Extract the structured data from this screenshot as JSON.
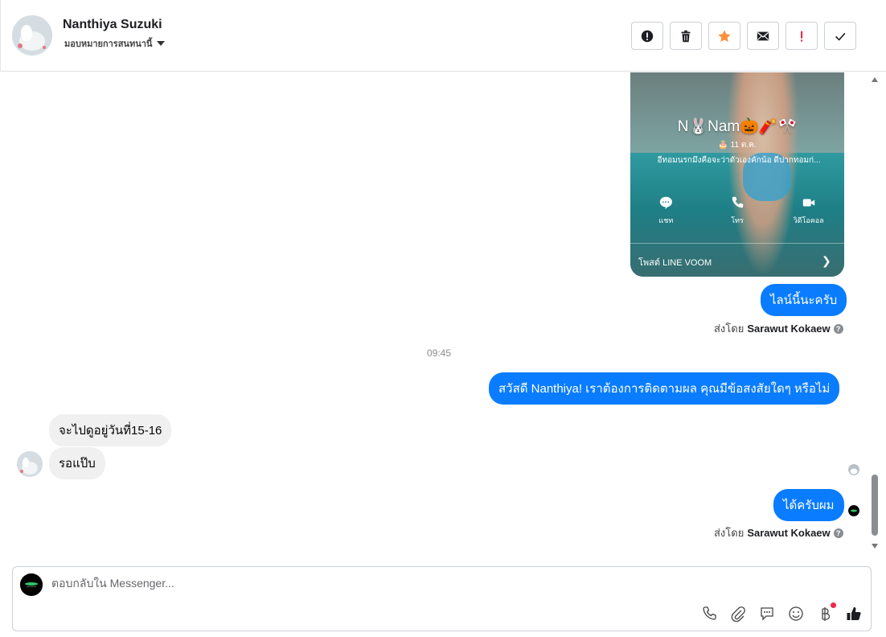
{
  "header": {
    "contact_name": "Nanthiya Suzuki",
    "assign_label": "มอบหมายการสนทนานี้",
    "toolbar": [
      {
        "name": "report-icon",
        "label": "!"
      },
      {
        "name": "trash-icon"
      },
      {
        "name": "star-icon"
      },
      {
        "name": "mail-icon"
      },
      {
        "name": "important-icon",
        "label": "!"
      },
      {
        "name": "check-icon"
      }
    ]
  },
  "profile_card": {
    "name": "N🐰Nam🎃🧨🎌",
    "date": "🎂 11 ต.ค.",
    "status": "อีทอมนรกมึงคือจะว่าตัวเองคักน้อ ดีปากทอมก่...",
    "actions": [
      {
        "label": "แชท",
        "icon": "chat-icon"
      },
      {
        "label": "โทร",
        "icon": "phone-icon"
      },
      {
        "label": "วิดีโอคอล",
        "icon": "video-icon"
      }
    ],
    "voom_label": "โพสต์ LINE VOOM"
  },
  "messages": [
    {
      "id": "m1",
      "direction": "out",
      "text": "ไลน์นี้นะครับ"
    },
    {
      "id": "m2",
      "direction": "out",
      "text": "สวัสดี Nanthiya! เราต้องการติดตามผล คุณมีข้อสงสัยใดๆ หรือไม่"
    },
    {
      "id": "m3",
      "direction": "in",
      "text": "จะไปดูอยู่วันที่15-16"
    },
    {
      "id": "m4",
      "direction": "in",
      "text": "รอแป๊บ"
    },
    {
      "id": "m5",
      "direction": "out",
      "text": "ได้ครับผม"
    }
  ],
  "sent_by_prefix": "ส่งโดย",
  "sent_by_name": "Sarawut Kokaew",
  "timestamp": "09:45",
  "composer": {
    "placeholder": "ตอบกลับใน Messenger...",
    "icons": [
      "phone-icon",
      "paperclip-icon",
      "chat-bubble-icon",
      "emoji-icon",
      "baht-icon",
      "thumbs-up-icon"
    ]
  },
  "colors": {
    "outgoing_bubble": "#0a7cff",
    "incoming_bubble": "#f0f0f0",
    "star": "#f7923b",
    "important": "#e41e3f"
  }
}
